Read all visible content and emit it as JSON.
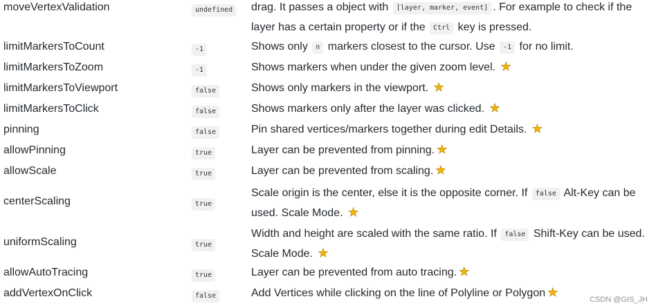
{
  "rows": [
    {
      "name": "moveVertexValidation",
      "default": "undefined",
      "desc": [
        {
          "t": "text",
          "v": "drag. It passes a object with "
        },
        {
          "t": "code",
          "v": "[layer, marker, event]"
        },
        {
          "t": "text",
          "v": ". For example to check if the layer has a certain property or if the "
        },
        {
          "t": "code",
          "v": "Ctrl"
        },
        {
          "t": "text",
          "v": " key is pressed."
        }
      ]
    },
    {
      "name": "limitMarkersToCount",
      "default": "-1",
      "desc": [
        {
          "t": "text",
          "v": "Shows only "
        },
        {
          "t": "code",
          "v": "n"
        },
        {
          "t": "text",
          "v": " markers closest to the cursor. Use "
        },
        {
          "t": "code",
          "v": "-1"
        },
        {
          "t": "text",
          "v": " for no limit."
        }
      ]
    },
    {
      "name": "limitMarkersToZoom",
      "default": "-1",
      "desc": [
        {
          "t": "text",
          "v": "Shows markers when under the given zoom level. "
        },
        {
          "t": "star",
          "v": "star-icon"
        }
      ]
    },
    {
      "name": "limitMarkersToViewport",
      "default": "false",
      "desc": [
        {
          "t": "text",
          "v": "Shows only markers in the viewport. "
        },
        {
          "t": "star",
          "v": "star-icon"
        }
      ]
    },
    {
      "name": "limitMarkersToClick",
      "default": "false",
      "desc": [
        {
          "t": "text",
          "v": "Shows markers only after the layer was clicked. "
        },
        {
          "t": "star",
          "v": "star-icon"
        }
      ]
    },
    {
      "name": "pinning",
      "default": "false",
      "desc": [
        {
          "t": "text",
          "v": "Pin shared vertices/markers together during edit Details. "
        },
        {
          "t": "star",
          "v": "star-icon"
        }
      ]
    },
    {
      "name": "allowPinning",
      "default": "true",
      "desc": [
        {
          "t": "text",
          "v": "Layer can be prevented from pinning."
        },
        {
          "t": "star",
          "v": "star-icon"
        }
      ]
    },
    {
      "name": "allowScale",
      "default": "true",
      "desc": [
        {
          "t": "text",
          "v": "Layer can be prevented from scaling."
        },
        {
          "t": "star",
          "v": "star-icon"
        }
      ]
    },
    {
      "name": "centerScaling",
      "default": "true",
      "desc": [
        {
          "t": "text",
          "v": "Scale origin is the center, else it is the opposite corner. If "
        },
        {
          "t": "code",
          "v": "false"
        },
        {
          "t": "text",
          "v": " Alt-Key can be used. Scale Mode. "
        },
        {
          "t": "star",
          "v": "star-icon"
        }
      ]
    },
    {
      "name": "uniformScaling",
      "default": "true",
      "desc": [
        {
          "t": "text",
          "v": "Width and height are scaled with the same ratio. If "
        },
        {
          "t": "code",
          "v": "false"
        },
        {
          "t": "text",
          "v": " Shift-Key can be used. Scale Mode. "
        },
        {
          "t": "star",
          "v": "star-icon"
        }
      ]
    },
    {
      "name": "allowAutoTracing",
      "default": "true",
      "desc": [
        {
          "t": "text",
          "v": "Layer can be prevented from auto tracing."
        },
        {
          "t": "star",
          "v": "star-icon"
        }
      ]
    },
    {
      "name": "addVertexOnClick",
      "default": "false",
      "desc": [
        {
          "t": "text",
          "v": "Add Vertices while clicking on the line of Polyline or Polygon"
        },
        {
          "t": "star",
          "v": "star-icon"
        }
      ]
    }
  ],
  "watermark": "CSDN @GIS_JH",
  "colors": {
    "star": "#f5b800",
    "code_bg": "#eff1f3",
    "text": "#24292e"
  }
}
